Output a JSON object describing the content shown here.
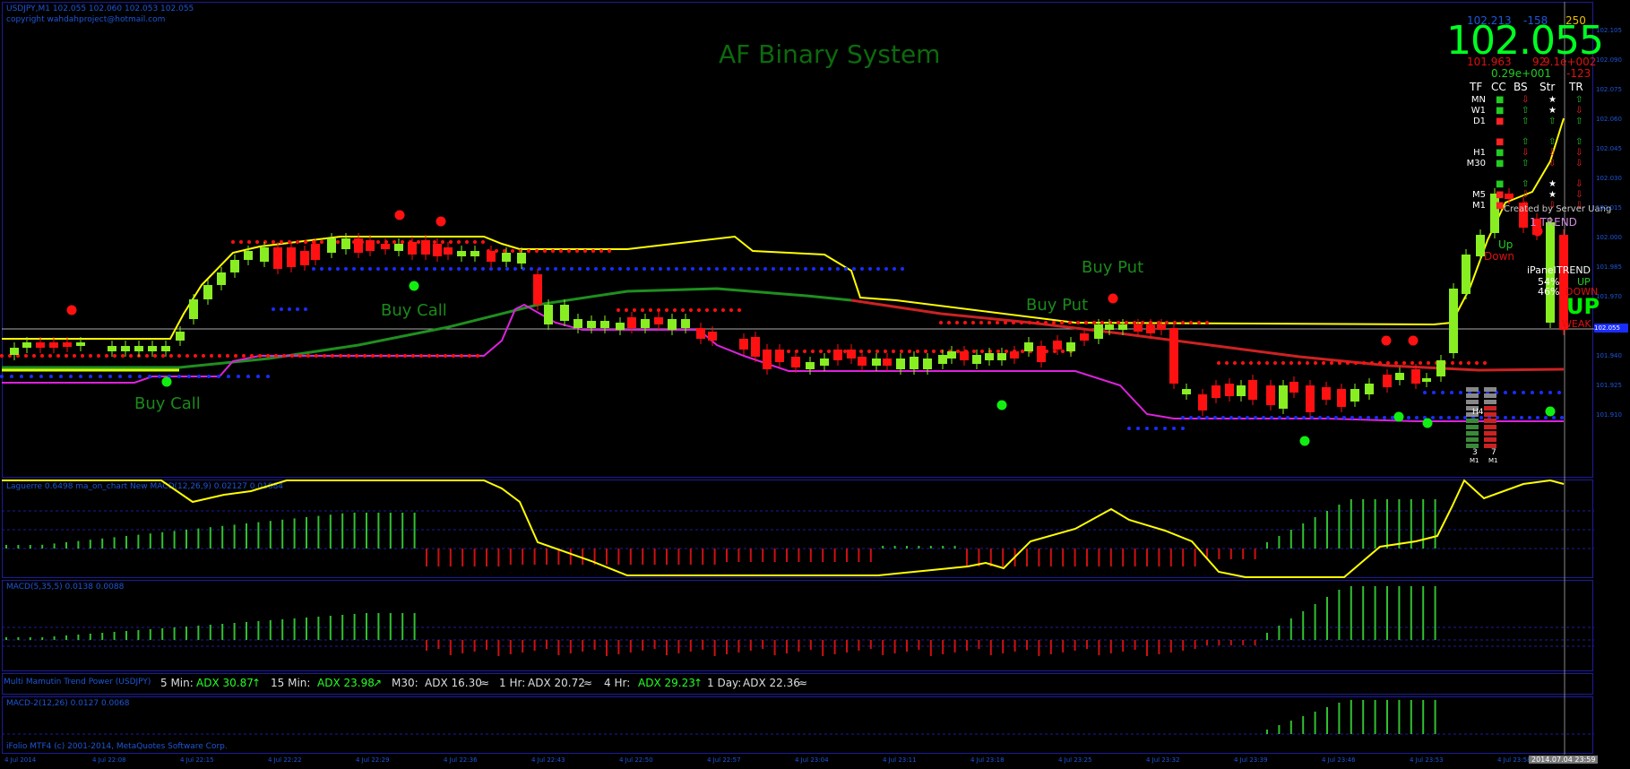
{
  "window": {
    "symbol_line": "USDJPY,M1  102.055 102.060 102.053 102.055",
    "copyright_line": "copyright wahdahproject@hotmail.com"
  },
  "chart_title": "AF Binary System",
  "signals": {
    "buy_call_1": "Buy Call",
    "buy_call_2": "Buy Call",
    "buy_put_1": "Buy Put",
    "buy_put_2": "Buy Put"
  },
  "price_panel": {
    "price": "102.055",
    "top_left": "102.213",
    "top_mid": "-158",
    "top_right": "250",
    "second_left": "101.963",
    "second_mid": "92",
    "second_right": "9.1e+002",
    "third_left": "0.29e+001",
    "third_right": "-123"
  },
  "mtf_table": {
    "headers": [
      "TF",
      "CC",
      "BS",
      "Str",
      "TR"
    ],
    "rows": [
      {
        "tf": "MN"
      },
      {
        "tf": "W1"
      },
      {
        "tf": "D1"
      },
      {
        "tf": ""
      },
      {
        "tf": "H1"
      },
      {
        "tf": "M30"
      },
      {
        "tf": ""
      },
      {
        "tf": "M5"
      },
      {
        "tf": "M1"
      }
    ],
    "created_by": "Created by Server Uang",
    "trend_label": "1 TREND",
    "up_label": "Up",
    "down_label": "Down",
    "ipanel_label": "iPanel",
    "ipanel_trend": "TREND",
    "ipanel_up_pct": "54%",
    "ipanel_down_pct": "46%",
    "ipanel_up": "UP",
    "ipanel_down": "DOWN",
    "big_up": "UP",
    "weak": "WEAK",
    "h4_label": "H4",
    "m1_left_num": "3",
    "m1_right_num": "7",
    "m1_left": "M1",
    "m1_right": "M1"
  },
  "subpanes": {
    "sub1_title": "Laguerre 0.6498    ma_on_chart New  MACD(12,26,9) 0.02127  0.01884",
    "sub2_title": "MACD(5,35,5) 0.0138  0.0088",
    "adx_title": "Multi Mamutin Trend Power (USDJPY)",
    "sub3_title": "MACD-2(12,26) 0.0127 0.0068",
    "sub3_footer": "iFolio MTF4 (c) 2001-2014, MetaQuotes Software Corp."
  },
  "adx": [
    {
      "label": "5 Min:",
      "value": "ADX 30.87",
      "dir": "↑",
      "color": "#22ff22"
    },
    {
      "label": "15 Min:",
      "value": "ADX 23.98",
      "dir": "↗",
      "color": "#22ff22"
    },
    {
      "label": "M30:",
      "value": "ADX 16.30",
      "dir": "≈",
      "color": "#dddddd"
    },
    {
      "label": "1 Hr:",
      "value": "ADX 20.72",
      "dir": "≈",
      "color": "#dddddd"
    },
    {
      "label": "4 Hr:",
      "value": "ADX 29.23",
      "dir": "↑",
      "color": "#22ff22"
    },
    {
      "label": "1 Day:",
      "value": "ADX 22.36",
      "dir": "≈",
      "color": "#dddddd"
    }
  ],
  "y_ticks_main": [
    "102.105",
    "102.090",
    "102.075",
    "102.060",
    "102.045",
    "102.030",
    "102.015",
    "102.000",
    "101.985",
    "101.970",
    "101.955",
    "101.940",
    "101.925",
    "101.910"
  ],
  "current_price_tag": "102.055",
  "x_ticks": [
    "4 Jul 2014",
    "4 Jul 22:08",
    "4 Jul 22:15",
    "4 Jul 22:22",
    "4 Jul 22:29",
    "4 Jul 22:36",
    "4 Jul 22:43",
    "4 Jul 22:50",
    "4 Jul 22:57",
    "4 Jul 23:04",
    "4 Jul 23:11",
    "4 Jul 23:18",
    "4 Jul 23:25",
    "4 Jul 23:32",
    "4 Jul 23:39",
    "4 Jul 23:46",
    "4 Jul 23:53",
    "4 Jul 23:58"
  ],
  "time_badge": "2014.07.04 23:59",
  "colors": {
    "bull": "#88ee22",
    "bear": "#ff1111",
    "upper_band": "#ffff00",
    "mid_ma": "#d8ff00",
    "green_ma": "#1f8f1f",
    "red_ma": "#cc2222",
    "magenta": "#dd22dd",
    "blue_dots": "#1a2dff",
    "axis": "#1c1c9a"
  }
}
